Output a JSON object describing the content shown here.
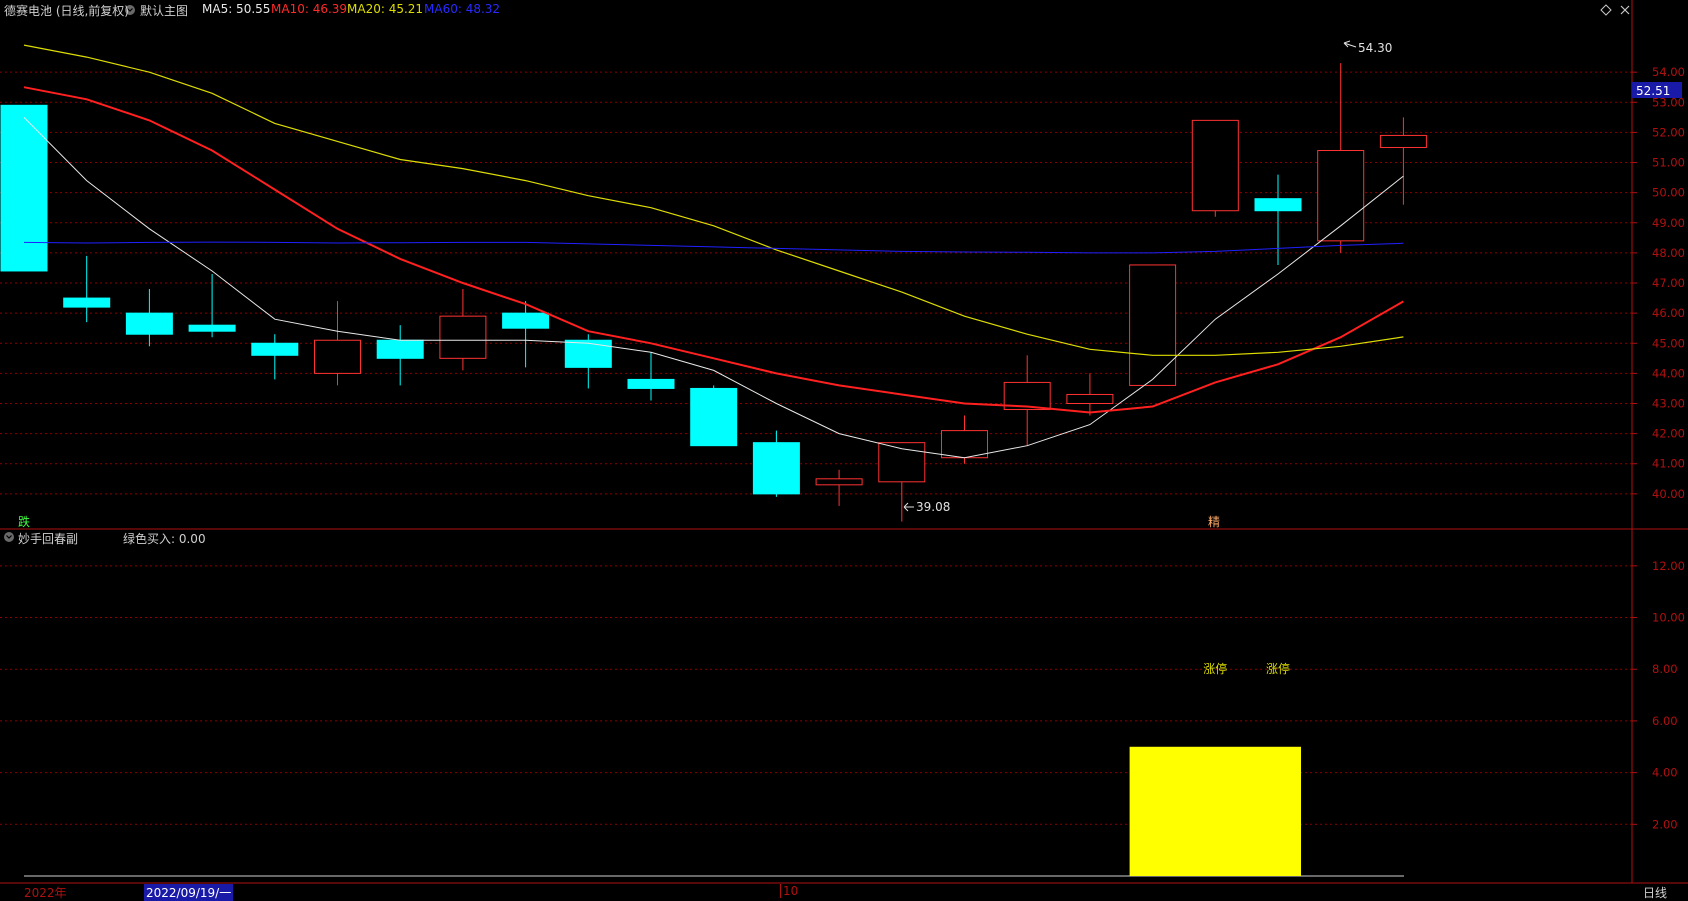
{
  "header": {
    "stock_name": "德赛电池 (日线,前复权)",
    "indicator_name": "默认主图",
    "ma5": "MA5: 50.55",
    "ma10": "MA10: 46.39",
    "ma20": "MA20: 45.21",
    "ma60": "MA60: 48.32",
    "toolbar_icons": [
      "diamond-icon",
      "close-icon"
    ]
  },
  "sub_header": {
    "indicator_name": "妙手回春副",
    "value_text": "绿色买入: 0.00"
  },
  "main_markers": {
    "left_tag": "跌",
    "right_tag": "精",
    "high_label": "54.30",
    "low_label": "39.08",
    "current_price": "52.51"
  },
  "sub_markers": {
    "limit_up_1": "涨停",
    "limit_up_2": "涨停"
  },
  "footer": {
    "year": "2022年",
    "cursor_date": "2022/09/19/一",
    "month": "10",
    "period": "日线"
  },
  "colors": {
    "up": "#ff3232",
    "down": "#00ffff",
    "ma5": "#e8e8e8",
    "ma10": "#ff2020",
    "ma20": "#dddd00",
    "ma60": "#2020ff",
    "grid": "#8b0000",
    "axis": "#b01010",
    "sub_bar": "#ffff00",
    "label_yellow": "#dddd00"
  },
  "chart_data": [
    {
      "type": "candlestick",
      "title": "德赛电池 (日线,前复权)",
      "ylim": [
        38.9,
        55.4
      ],
      "yticks": [
        "40.00",
        "41.00",
        "42.00",
        "43.00",
        "44.00",
        "45.00",
        "46.00",
        "47.00",
        "48.00",
        "49.00",
        "50.00",
        "51.00",
        "52.00",
        "53.00",
        "54.00"
      ],
      "candles": [
        {
          "o": 52.9,
          "h": 52.9,
          "l": 47.4,
          "c": 47.4
        },
        {
          "o": 46.5,
          "h": 47.9,
          "l": 45.7,
          "c": 46.2
        },
        {
          "o": 46.0,
          "h": 46.8,
          "l": 44.9,
          "c": 45.3
        },
        {
          "o": 45.6,
          "h": 47.3,
          "l": 45.2,
          "c": 45.4
        },
        {
          "o": 45.0,
          "h": 45.3,
          "l": 43.8,
          "c": 44.6
        },
        {
          "o": 44.0,
          "h": 46.4,
          "l": 43.6,
          "c": 45.1
        },
        {
          "o": 45.1,
          "h": 45.6,
          "l": 43.6,
          "c": 44.5
        },
        {
          "o": 44.5,
          "h": 46.8,
          "l": 44.1,
          "c": 45.9
        },
        {
          "o": 46.0,
          "h": 46.4,
          "l": 44.2,
          "c": 45.5
        },
        {
          "o": 45.1,
          "h": 45.3,
          "l": 43.5,
          "c": 44.2
        },
        {
          "o": 43.8,
          "h": 44.7,
          "l": 43.1,
          "c": 43.5
        },
        {
          "o": 43.5,
          "h": 43.6,
          "l": 41.6,
          "c": 41.6
        },
        {
          "o": 41.7,
          "h": 42.1,
          "l": 39.9,
          "c": 40.0
        },
        {
          "o": 40.3,
          "h": 40.8,
          "l": 39.6,
          "c": 40.5
        },
        {
          "o": 40.4,
          "h": 41.7,
          "l": 39.08,
          "c": 41.7
        },
        {
          "o": 41.2,
          "h": 42.6,
          "l": 41.0,
          "c": 42.1
        },
        {
          "o": 42.8,
          "h": 44.6,
          "l": 41.6,
          "c": 43.7
        },
        {
          "o": 43.0,
          "h": 44.0,
          "l": 42.6,
          "c": 43.3
        },
        {
          "o": 43.6,
          "h": 47.6,
          "l": 43.6,
          "c": 47.6
        },
        {
          "o": 49.4,
          "h": 52.4,
          "l": 49.2,
          "c": 52.4
        },
        {
          "o": 49.8,
          "h": 50.6,
          "l": 47.6,
          "c": 49.4
        },
        {
          "o": 48.4,
          "h": 54.3,
          "l": 48.0,
          "c": 51.4
        },
        {
          "o": 51.5,
          "h": 52.5,
          "l": 49.6,
          "c": 51.9
        }
      ],
      "series": [
        {
          "name": "MA5",
          "values": [
            52.5,
            50.4,
            48.8,
            47.4,
            45.8,
            45.4,
            45.1,
            45.1,
            45.1,
            45.0,
            44.7,
            44.1,
            43.0,
            42.0,
            41.5,
            41.2,
            41.6,
            42.3,
            43.8,
            45.8,
            47.3,
            48.9,
            50.55
          ]
        },
        {
          "name": "MA10",
          "values": [
            53.5,
            53.1,
            52.4,
            51.4,
            50.1,
            48.8,
            47.8,
            47.0,
            46.3,
            45.4,
            45.0,
            44.5,
            44.0,
            43.6,
            43.3,
            43.0,
            42.9,
            42.7,
            42.9,
            43.7,
            44.3,
            45.2,
            46.39
          ]
        },
        {
          "name": "MA20",
          "values": [
            54.9,
            54.5,
            54.0,
            53.3,
            52.3,
            51.7,
            51.1,
            50.8,
            50.4,
            49.9,
            49.5,
            48.9,
            48.1,
            47.4,
            46.7,
            45.9,
            45.3,
            44.8,
            44.6,
            44.6,
            44.7,
            44.9,
            45.21
          ]
        },
        {
          "name": "MA60",
          "values": [
            48.35,
            48.33,
            48.35,
            48.36,
            48.35,
            48.33,
            48.34,
            48.35,
            48.35,
            48.3,
            48.25,
            48.2,
            48.15,
            48.1,
            48.05,
            48.03,
            48.02,
            48.0,
            48.0,
            48.05,
            48.15,
            48.25,
            48.32
          ]
        }
      ]
    },
    {
      "type": "bar",
      "title": "妙手回春副",
      "ylim": [
        0,
        13
      ],
      "yticks": [
        "2.00",
        "4.00",
        "6.00",
        "8.00",
        "10.00",
        "12.00"
      ],
      "bars": [
        {
          "from_candle": 18,
          "to_candle": 20,
          "value": 5.0
        }
      ],
      "labels": [
        {
          "candle": 19,
          "value": 8.0,
          "text": "涨停"
        },
        {
          "candle": 20,
          "value": 8.0,
          "text": "涨停"
        }
      ]
    }
  ]
}
